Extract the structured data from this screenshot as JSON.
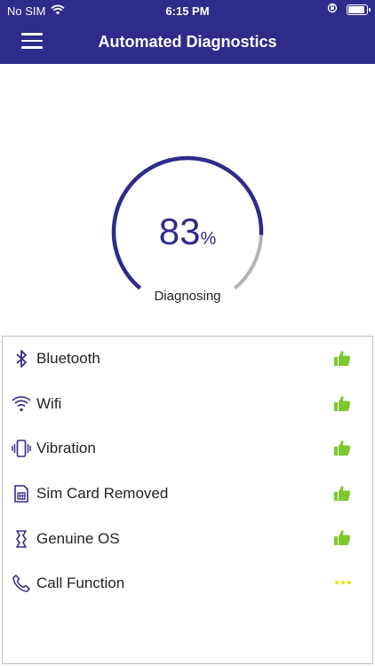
{
  "status_bar": {
    "carrier": "No SIM",
    "time": "6:15 PM"
  },
  "header": {
    "title": "Automated Diagnostics"
  },
  "progress": {
    "value": 83,
    "unit": "%",
    "label": "Diagnosing",
    "ring_color": "#2e2b8a",
    "track_color": "#b3b3b3"
  },
  "diagnostics": [
    {
      "label": "Bluetooth",
      "icon": "bluetooth-icon",
      "status": "passed"
    },
    {
      "label": "Wifi",
      "icon": "wifi-icon",
      "status": "passed"
    },
    {
      "label": "Vibration",
      "icon": "vibration-icon",
      "status": "passed"
    },
    {
      "label": "Sim Card Removed",
      "icon": "sim-card-icon",
      "status": "passed"
    },
    {
      "label": "Genuine OS",
      "icon": "genuine-os-icon",
      "status": "passed"
    },
    {
      "label": "Call Function",
      "icon": "phone-icon",
      "status": "in-progress"
    }
  ],
  "colors": {
    "brand": "#2e2b8a",
    "passed": "#7dc82e",
    "in_progress": "#e9e500"
  }
}
